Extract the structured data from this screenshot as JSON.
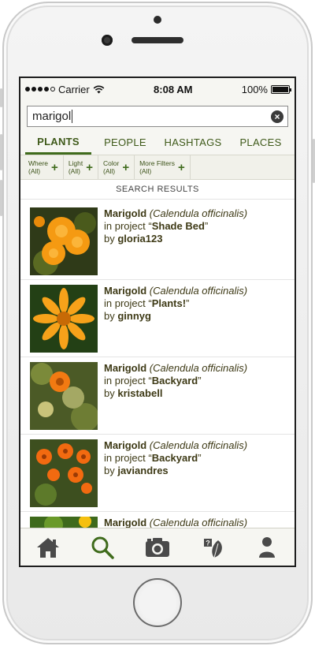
{
  "status": {
    "carrier": "Carrier",
    "time": "8:08 AM",
    "battery": "100%",
    "battery_level": 1.0
  },
  "search": {
    "value": "marigol",
    "clear_icon": "close-icon"
  },
  "tabs": [
    {
      "label": "PLANTS",
      "active": true
    },
    {
      "label": "PEOPLE",
      "active": false
    },
    {
      "label": "HASHTAGS",
      "active": false
    },
    {
      "label": "PLACES",
      "active": false
    }
  ],
  "filters": [
    {
      "line1": "Where",
      "line2": "(All)"
    },
    {
      "line1": "Light",
      "line2": "(All)"
    },
    {
      "line1": "Color",
      "line2": "(All)"
    },
    {
      "line1": "More Filters",
      "line2": "(All)"
    }
  ],
  "results_header": "SEARCH RESULTS",
  "results": [
    {
      "name": "Marigold",
      "scientific": "(Calendula officinalis)",
      "project_prefix": "in project “",
      "project": "Shade Bed",
      "project_suffix": "”",
      "by_prefix": "by ",
      "user": "gloria123"
    },
    {
      "name": "Marigold",
      "scientific": "(Calendula officinalis)",
      "project_prefix": "in project “",
      "project": "Plants!",
      "project_suffix": "”",
      "by_prefix": "by ",
      "user": "ginnyg"
    },
    {
      "name": "Marigold",
      "scientific": "(Calendula officinalis)",
      "project_prefix": "in project “",
      "project": "Backyard",
      "project_suffix": "”",
      "by_prefix": "by ",
      "user": "kristabell"
    },
    {
      "name": "Marigold",
      "scientific": "(Calendula officinalis)",
      "project_prefix": "in project “",
      "project": "Backyard",
      "project_suffix": "”",
      "by_prefix": "by ",
      "user": "javiandres"
    },
    {
      "name": "Marigold",
      "scientific": "(Calendula officinalis)",
      "project_prefix": "",
      "project": "",
      "project_suffix": "",
      "by_prefix": "",
      "user": ""
    }
  ],
  "tab_bar": [
    {
      "icon": "home-icon"
    },
    {
      "icon": "search-icon",
      "active": true
    },
    {
      "icon": "camera-icon"
    },
    {
      "icon": "plant-question-icon"
    },
    {
      "icon": "profile-icon"
    }
  ],
  "colors": {
    "accent": "#3f6b1c",
    "text": "#3e3a16",
    "marigold": "#f59a12"
  }
}
